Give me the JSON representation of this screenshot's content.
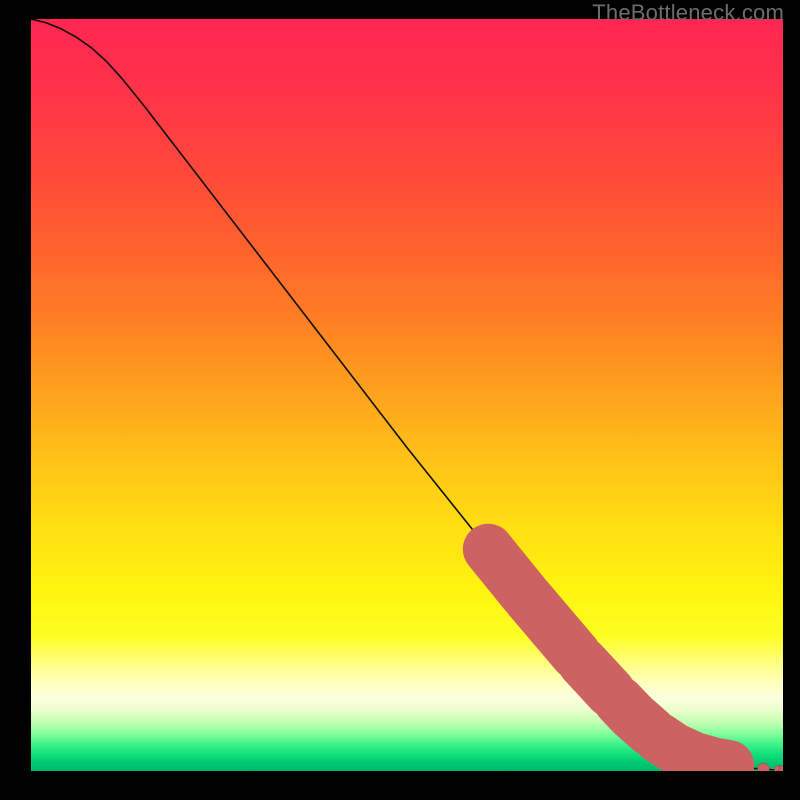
{
  "watermark": "TheBottleneck.com",
  "colors": {
    "curve_stroke": "#101010",
    "marker_fill": "#cc6262",
    "marker_stroke": "#8c3c3c"
  },
  "gradient_stops": [
    {
      "offset": 0.0,
      "color": "#ff2651"
    },
    {
      "offset": 0.1,
      "color": "#ff3448"
    },
    {
      "offset": 0.2,
      "color": "#ff483a"
    },
    {
      "offset": 0.3,
      "color": "#ff612e"
    },
    {
      "offset": 0.4,
      "color": "#ff7f24"
    },
    {
      "offset": 0.5,
      "color": "#ffa31d"
    },
    {
      "offset": 0.6,
      "color": "#ffc716"
    },
    {
      "offset": 0.68,
      "color": "#ffe012"
    },
    {
      "offset": 0.76,
      "color": "#fff40e"
    },
    {
      "offset": 0.82,
      "color": "#fcff22"
    },
    {
      "offset": 0.862,
      "color": "#ffff8e"
    },
    {
      "offset": 0.884,
      "color": "#ffffc0"
    },
    {
      "offset": 0.903,
      "color": "#fdffdf"
    },
    {
      "offset": 0.92,
      "color": "#e9ffca"
    },
    {
      "offset": 0.935,
      "color": "#c4ffb3"
    },
    {
      "offset": 0.95,
      "color": "#84ff9a"
    },
    {
      "offset": 0.964,
      "color": "#41f28a"
    },
    {
      "offset": 0.976,
      "color": "#16e37e"
    },
    {
      "offset": 0.988,
      "color": "#00cc72"
    },
    {
      "offset": 1.0,
      "color": "#00b867"
    }
  ],
  "chart_data": {
    "type": "line",
    "title": "",
    "xlabel": "",
    "ylabel": "",
    "xlim": [
      0,
      100
    ],
    "ylim": [
      0,
      100
    ],
    "series": [
      {
        "name": "curve",
        "x": [
          0,
          2,
          4,
          6,
          8,
          10,
          12,
          15,
          20,
          30,
          40,
          50,
          60,
          65,
          70,
          75,
          80,
          82,
          84,
          86,
          88,
          90,
          92,
          94,
          95.5,
          97,
          98.5,
          100
        ],
        "y": [
          100,
          99.5,
          98.7,
          97.6,
          96.2,
          94.4,
          92.2,
          88.5,
          82.0,
          69.0,
          56.0,
          43.0,
          30.5,
          24.3,
          18.3,
          12.6,
          7.4,
          5.6,
          4.0,
          2.8,
          1.9,
          1.3,
          0.85,
          0.55,
          0.4,
          0.28,
          0.18,
          0.12
        ]
      }
    ],
    "markers": [
      {
        "xs": [
          59.8,
          97.4
        ],
        "r": 6,
        "kind": "big_round"
      },
      {
        "xs": [
          94.8,
          95.3,
          99.4,
          100.0
        ],
        "r": 4.3,
        "kind": "small_round"
      },
      {
        "segments": [
          [
            60.8,
            65.6
          ],
          [
            66.2,
            72.4
          ],
          [
            73.4,
            77.0
          ],
          [
            78.2,
            80.0
          ],
          [
            80.6,
            82.4
          ],
          [
            83.4,
            85.0
          ],
          [
            85.8,
            88.0
          ],
          [
            88.8,
            90.4
          ],
          [
            91.4,
            92.8
          ]
        ],
        "half_width": 5.0,
        "kind": "capsule"
      }
    ]
  }
}
